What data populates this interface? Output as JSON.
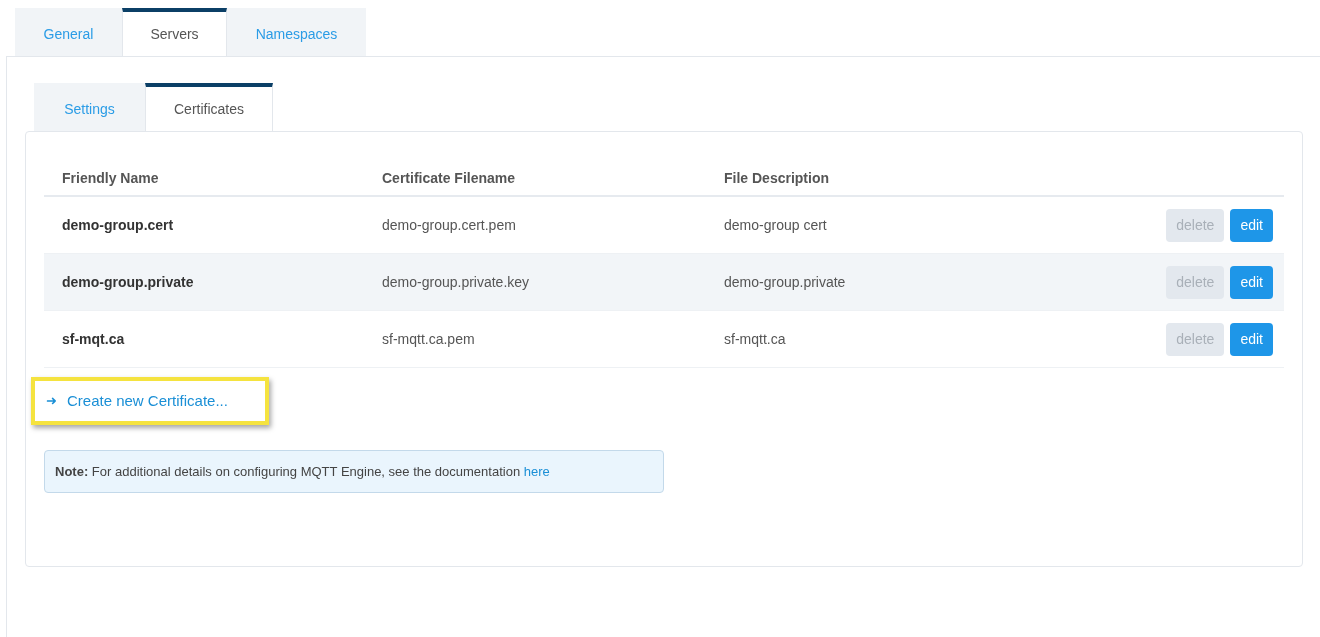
{
  "tabs": [
    {
      "label": "General",
      "selected": false
    },
    {
      "label": "Servers",
      "selected": true
    },
    {
      "label": "Namespaces",
      "selected": false
    }
  ],
  "subtabs": [
    {
      "label": "Settings",
      "selected": false
    },
    {
      "label": "Certificates",
      "selected": true
    }
  ],
  "table": {
    "columns": [
      "Friendly Name",
      "Certificate Filename",
      "File Description"
    ],
    "rows": [
      {
        "cells": [
          "demo-group.cert",
          "demo-group.cert.pem",
          "demo-group cert"
        ],
        "delete": {
          "label": "delete",
          "disabled": true
        },
        "edit": {
          "label": "edit",
          "disabled": false
        }
      },
      {
        "cells": [
          "demo-group.private",
          "demo-group.private.key",
          "demo-group.private"
        ],
        "delete": {
          "label": "delete",
          "disabled": true
        },
        "edit": {
          "label": "edit",
          "disabled": false
        }
      },
      {
        "cells": [
          "sf-mqt.ca",
          "sf-mqtt.ca.pem",
          "sf-mqtt.ca"
        ],
        "delete": {
          "label": "delete",
          "disabled": true
        },
        "edit": {
          "label": "edit",
          "disabled": false
        }
      }
    ]
  },
  "create_link": {
    "icon": "➜",
    "label": "Create new Certificate...",
    "highlighted": true
  },
  "note": {
    "text": "**Note:** For additional details on configuring MQTT Engine, see the documentation",
    "link": "here"
  }
}
